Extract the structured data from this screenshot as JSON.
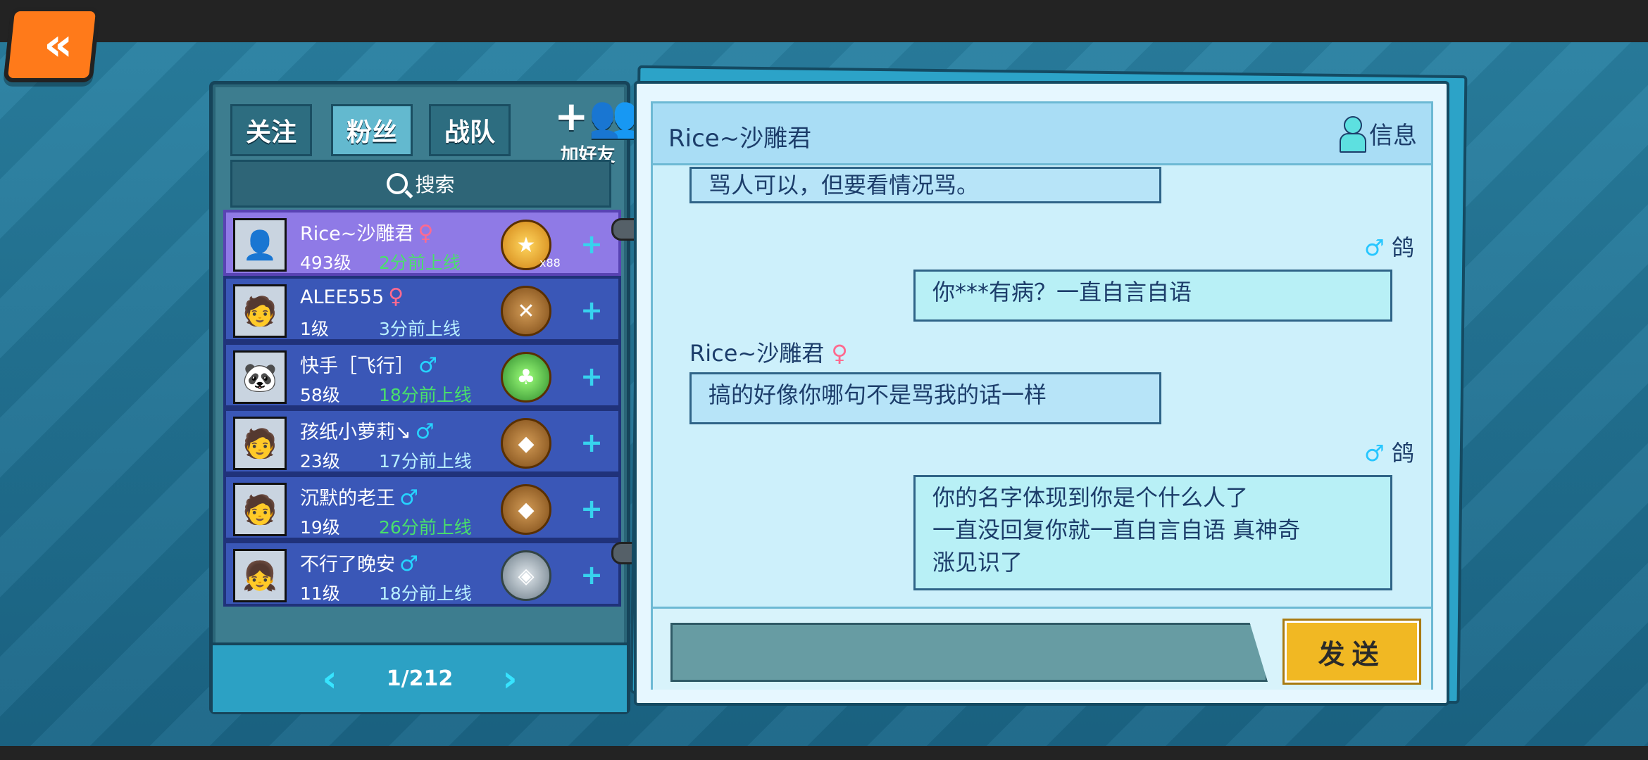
{
  "nav": {
    "back_icon": "back-double-chevron-icon"
  },
  "tabs": [
    {
      "label": "关注",
      "active": false
    },
    {
      "label": "粉丝",
      "active": true
    },
    {
      "label": "战队",
      "active": false
    }
  ],
  "add_friend_label": "加好友",
  "search_label": "搜索",
  "friends": [
    {
      "name": "Rice~沙雕君",
      "gender": "♀",
      "level": "493级",
      "online": "2分前上线",
      "badge_count": "x88"
    },
    {
      "name": "ALEE555",
      "gender": "♀",
      "level": "1级",
      "online": "3分前上线",
      "badge_count": ""
    },
    {
      "name": "快手［飞行］",
      "gender": "♂",
      "level": "58级",
      "online": "18分前上线",
      "badge_count": ""
    },
    {
      "name": "孩纸小萝莉↘",
      "gender": "♂",
      "level": "23级",
      "online": "17分前上线",
      "badge_count": ""
    },
    {
      "name": "沉默的老王",
      "gender": "♂",
      "level": "19级",
      "online": "26分前上线",
      "badge_count": ""
    },
    {
      "name": "不行了晚安",
      "gender": "♂",
      "level": "11级",
      "online": "18分前上线",
      "badge_count": ""
    }
  ],
  "pager": {
    "label": "1/212"
  },
  "chat": {
    "title": "Rice~沙雕君",
    "info_label": "信息",
    "messages": [
      {
        "sender": "",
        "gender": "",
        "text": "骂人可以，但要看情况骂。"
      },
      {
        "sender": "鸽",
        "gender": "♂",
        "text": "你***有病？一直自言自语"
      },
      {
        "sender": "Rice~沙雕君",
        "gender": "♀",
        "text": "搞的好像你哪句不是骂我的话一样"
      },
      {
        "sender": "鸽",
        "gender": "♂",
        "line1": "你的名字体现到你是个什么人了",
        "line2": "一直没回复你就一直自言自语 真神奇",
        "line3": "涨见识了"
      }
    ],
    "send_label": "发送"
  },
  "colors": {
    "accent": "#37d3ee",
    "send": "#f1b823",
    "selected_row": "#8f7ae6",
    "row": "#3a57b7"
  }
}
